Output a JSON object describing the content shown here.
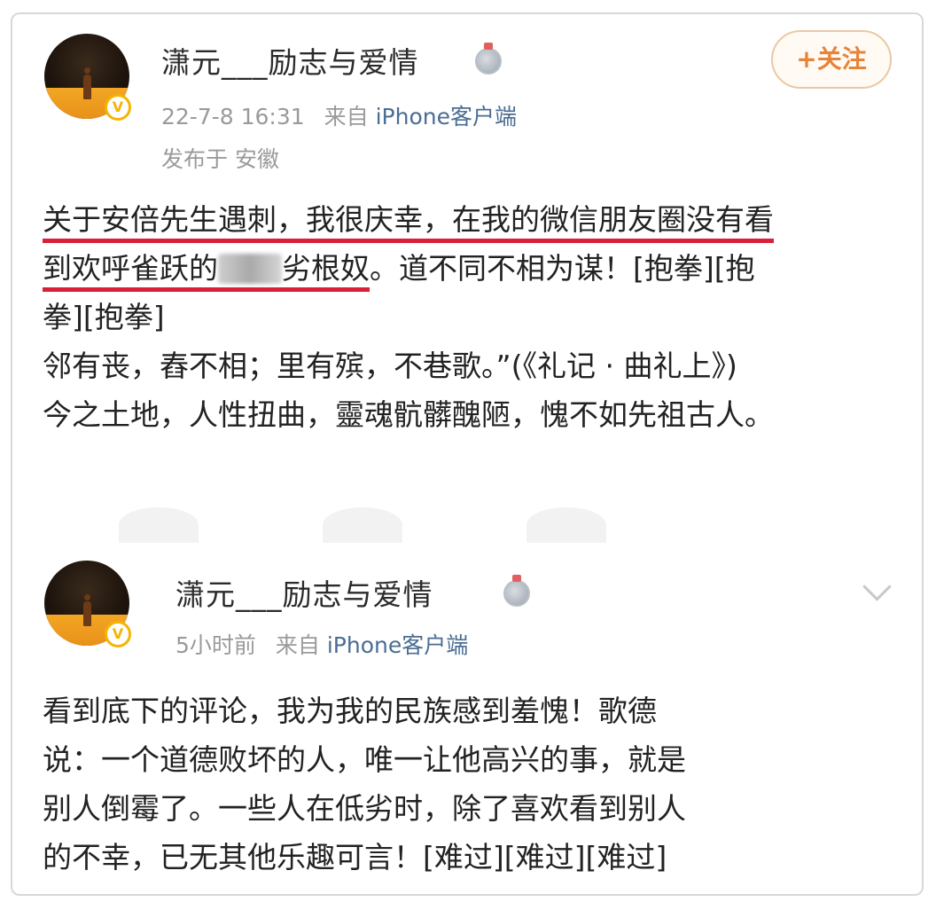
{
  "posts": [
    {
      "username": "潇元___励志与爱情",
      "medal_icon": "medal-icon",
      "verified_icon": "verified-v-icon",
      "time": "22-7-8 16:31",
      "source_prefix": "来自",
      "source_client": "iPhone客户端",
      "location": "发布于 安徽",
      "follow_label": "+关注",
      "body": {
        "underlined_1": "关于安倍先生遇刺，我很庆幸，在我的微信朋友圈没有看",
        "underlined_2a": "到欢呼雀跃的",
        "underlined_2b": "劣根奴",
        "tail_2": "。道不同不相为谋！[抱拳][抱",
        "line_3": "拳][抱拳]",
        "line_4": "邻有丧，舂不相；里有殡，不巷歌。”(《礼记 · 曲礼上》)",
        "line_5": "今之土地，人性扭曲，靈魂骯髒醜陋，愧不如先祖古人。"
      }
    },
    {
      "username": "潇元___励志与爱情",
      "medal_icon": "medal-icon",
      "verified_icon": "verified-v-icon",
      "time": "5小时前",
      "source_prefix": "来自",
      "source_client": "iPhone客户端",
      "menu_icon": "chevron-down-icon",
      "body": {
        "line_1": "看到底下的评论，我为我的民族感到羞愧！歌德",
        "line_2": "说：一个道德败坏的人，唯一让他高兴的事，就是",
        "line_3": "别人倒霉了。一些人在低劣时，除了喜欢看到别人",
        "line_4": "的不幸，已无其他乐趣可言！[难过][难过][难过]"
      }
    }
  ],
  "colors": {
    "underline": "#d8203a",
    "client_link": "#4a6d93",
    "follow_text": "#e8833a",
    "verified": "#f5b400"
  }
}
